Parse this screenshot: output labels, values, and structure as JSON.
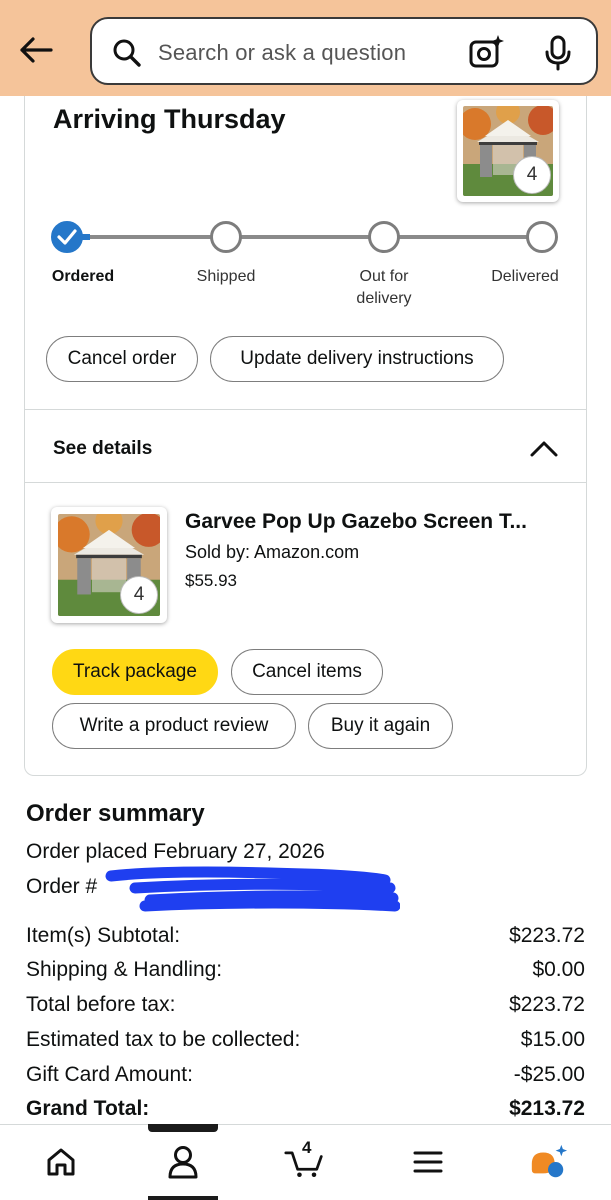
{
  "header": {
    "search_placeholder": "Search or ask a question"
  },
  "shipment": {
    "arrival_heading": "Arriving Thursday",
    "item_quantity": "4",
    "steps": [
      {
        "label": "Ordered",
        "done": true
      },
      {
        "label": "Shipped",
        "done": false
      },
      {
        "label": "Out for delivery",
        "done": false
      },
      {
        "label": "Delivered",
        "done": false
      }
    ],
    "actions": {
      "cancel_order": "Cancel order",
      "update_delivery": "Update delivery instructions"
    }
  },
  "details": {
    "toggle_label": "See details",
    "item": {
      "title": "Garvee Pop Up Gazebo Screen T...",
      "seller": "Sold by: Amazon.com",
      "price": "$55.93",
      "quantity": "4"
    },
    "actions": {
      "track_package": "Track package",
      "cancel_items": "Cancel items",
      "write_review": "Write a product review",
      "buy_again": "Buy it again"
    }
  },
  "summary": {
    "title": "Order summary",
    "order_placed": "Order placed February 27, 2026",
    "order_number_label": "Order #",
    "rows": [
      {
        "label": "Item(s) Subtotal:",
        "value": "$223.72"
      },
      {
        "label": "Shipping & Handling:",
        "value": "$0.00"
      },
      {
        "label": "Total before tax:",
        "value": "$223.72"
      },
      {
        "label": "Estimated tax to be collected:",
        "value": "$15.00"
      },
      {
        "label": "Gift Card Amount:",
        "value": "-$25.00"
      },
      {
        "label": "Grand Total:",
        "value": "$213.72"
      }
    ]
  },
  "bottom_nav": {
    "cart_count": "4",
    "active_tab": "account",
    "tabs": [
      "home-icon",
      "account-icon",
      "cart-icon",
      "menu-icon",
      "rufus-icon"
    ]
  },
  "colors": {
    "header_bg": "#f5c49a",
    "progress_blue": "#2577c9",
    "button_yellow": "#ffd814",
    "redaction_blue": "#1f3ff0",
    "rufus_orange": "#f08a24",
    "rufus_blue": "#2577c9"
  }
}
